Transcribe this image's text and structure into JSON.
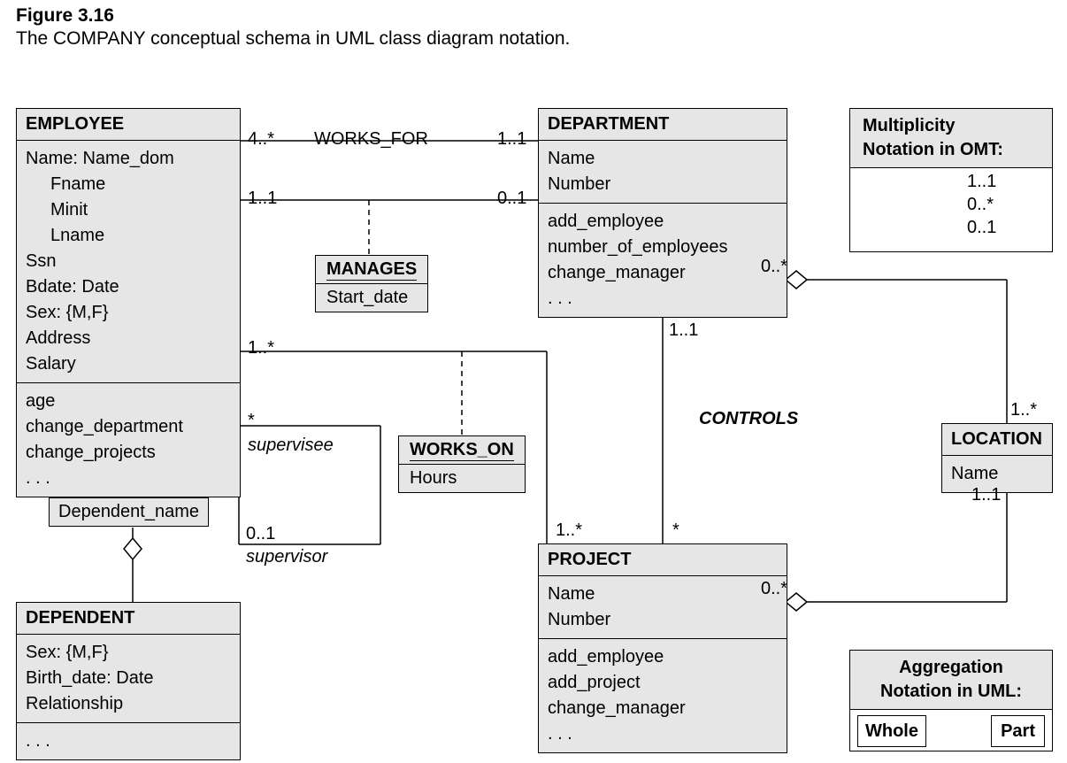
{
  "figure": {
    "number": "Figure 3.16",
    "caption": "The COMPANY conceptual schema in UML class diagram notation."
  },
  "classes": {
    "employee": {
      "name": "EMPLOYEE",
      "attrs": {
        "a1": "Name: Name_dom",
        "a1a": "Fname",
        "a1b": "Minit",
        "a1c": "Lname",
        "a2": "Ssn",
        "a3": "Bdate: Date",
        "a4": "Sex: {M,F}",
        "a5": "Address",
        "a6": "Salary"
      },
      "ops": {
        "o1": "age",
        "o2": "change_department",
        "o3": "change_projects",
        "o4": ". . ."
      }
    },
    "department": {
      "name": "DEPARTMENT",
      "attrs": {
        "a1": "Name",
        "a2": "Number"
      },
      "ops": {
        "o1": "add_employee",
        "o2": "number_of_employees",
        "o3": "change_manager",
        "o4": ". . ."
      }
    },
    "project": {
      "name": "PROJECT",
      "attrs": {
        "a1": "Name",
        "a2": "Number"
      },
      "ops": {
        "o1": "add_employee",
        "o2": "add_project",
        "o3": "change_manager",
        "o4": ". . ."
      }
    },
    "dependent": {
      "name": "DEPENDENT",
      "attrs": {
        "a1": "Sex: {M,F}",
        "a2": "Birth_date: Date",
        "a3": "Relationship"
      },
      "ops": {
        "o1": ". . ."
      }
    },
    "location": {
      "name": "LOCATION",
      "attrs": {
        "a1": "Name"
      }
    }
  },
  "assoc_classes": {
    "manages": {
      "name": "MANAGES",
      "attr": "Start_date"
    },
    "works_on": {
      "name": "WORKS_ON",
      "attr": "Hours"
    }
  },
  "qualifier": {
    "dependent_name": "Dependent_name"
  },
  "associations": {
    "works_for": {
      "label": "WORKS_FOR",
      "emp_mult": "4..*",
      "dept_mult": "1..1"
    },
    "manages": {
      "emp_mult": "1..1",
      "dept_mult": "0..1"
    },
    "works_on": {
      "emp_mult": "1..*",
      "proj_mult": "*"
    },
    "controls": {
      "label": "CONTROLS",
      "dept_mult": "1..1",
      "proj_mult": "1..*"
    },
    "supervision": {
      "supervisee_role": "supervisee",
      "supervisee_mult": "*",
      "supervisor_role": "supervisor",
      "supervisor_mult": "0..1"
    },
    "dept_location": {
      "dept_mult": "0..*",
      "loc_mult": "1..*"
    },
    "proj_location": {
      "proj_mult": "0..*",
      "loc_mult": "1..1"
    }
  },
  "legend_omt": {
    "title1": "Multiplicity",
    "title2": "Notation in OMT:",
    "r1": "1..1",
    "r2": "0..*",
    "r3": "0..1"
  },
  "legend_agg": {
    "title1": "Aggregation",
    "title2": "Notation in UML:",
    "whole": "Whole",
    "part": "Part"
  }
}
